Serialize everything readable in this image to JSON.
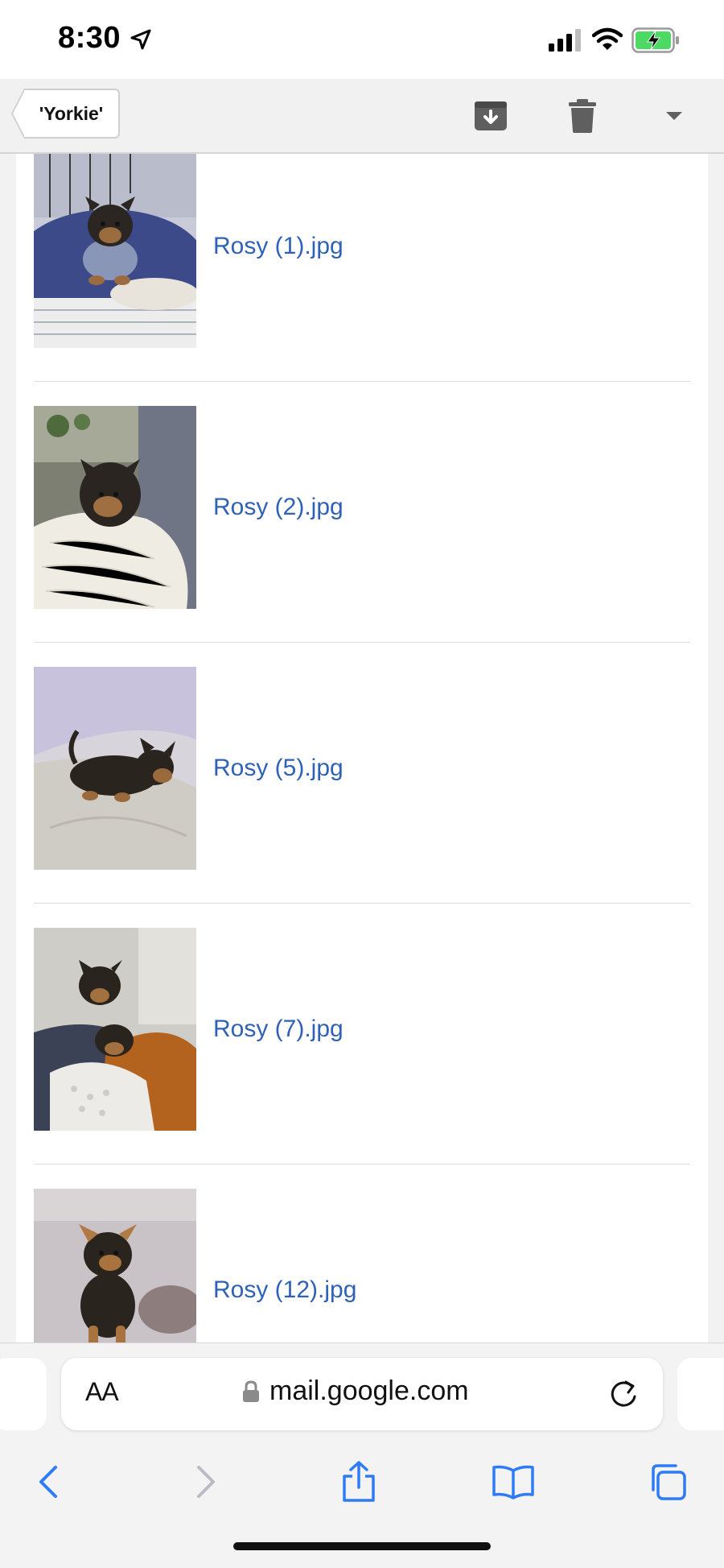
{
  "status_bar": {
    "time": "8:30",
    "icons": [
      "location-arrow-icon",
      "cellular-signal-icon",
      "wifi-icon",
      "battery-charging-icon"
    ]
  },
  "toolbar": {
    "label": "'Yorkie'",
    "actions": [
      "archive-icon",
      "trash-icon",
      "dropdown-arrow-icon"
    ]
  },
  "attachments": [
    {
      "name": "Rosy (1).jpg"
    },
    {
      "name": "Rosy (2).jpg"
    },
    {
      "name": "Rosy (5).jpg"
    },
    {
      "name": "Rosy (7).jpg"
    },
    {
      "name": "Rosy (12).jpg"
    }
  ],
  "safari": {
    "text_size_label": "AA",
    "url": "mail.google.com",
    "nav_icons": [
      "back-icon",
      "forward-icon",
      "share-icon",
      "bookmarks-icon",
      "tabs-icon"
    ]
  },
  "colors": {
    "link": "#2f62b6",
    "battery_green": "#4cd964",
    "toolbar_bg": "#f1f1f1"
  }
}
